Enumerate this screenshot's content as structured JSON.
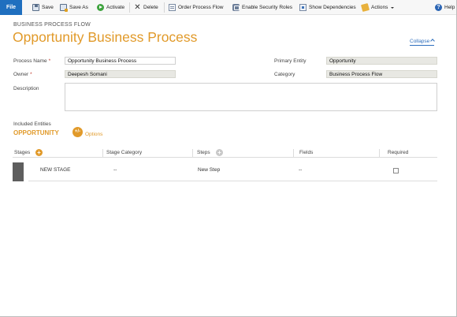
{
  "toolbar": {
    "file_label": "File",
    "save_label": "Save",
    "save_as_label": "Save As",
    "activate_label": "Activate",
    "delete_label": "Delete",
    "order_process_flow_label": "Order Process Flow",
    "enable_security_roles_label": "Enable Security Roles",
    "show_dependencies_label": "Show Dependencies",
    "actions_label": "Actions",
    "help_label": "Help"
  },
  "header": {
    "subtitle": "BUSINESS PROCESS FLOW",
    "title": "Opportunity Business Process",
    "collapse_label": "Collapse"
  },
  "form": {
    "process_name_label": "Process Name",
    "process_name_value": "Opportunity Business Process",
    "owner_label": "Owner",
    "owner_value": "Deepesh Somani",
    "description_label": "Description",
    "primary_entity_label": "Primary Entity",
    "primary_entity_value": "Opportunity",
    "category_label": "Category",
    "category_value": "Business Process Flow",
    "required_marker": "*"
  },
  "entities": {
    "label": "Included Entities",
    "entity_name": "OPPORTUNITY",
    "options_icon_text": "+/-",
    "options_label": "Options"
  },
  "grid": {
    "columns": {
      "stages": "Stages",
      "stage_category": "Stage Category",
      "steps": "Steps",
      "fields": "Fields",
      "required": "Required"
    },
    "rows": [
      {
        "stage": "NEW STAGE",
        "stage_category": "--",
        "step": "New Step",
        "fields": "--",
        "required": false
      }
    ]
  },
  "icons": {
    "save": "save-icon",
    "save_as": "save-as-icon",
    "activate": "activate-icon",
    "delete": "delete-icon",
    "order": "order-flow-icon",
    "security": "security-roles-icon",
    "dependencies": "dependencies-icon",
    "actions": "actions-icon",
    "help": "help-icon"
  },
  "colors": {
    "accent": "#e19a2a",
    "file_button": "#1f6fbf",
    "link": "#2f6fbd"
  }
}
